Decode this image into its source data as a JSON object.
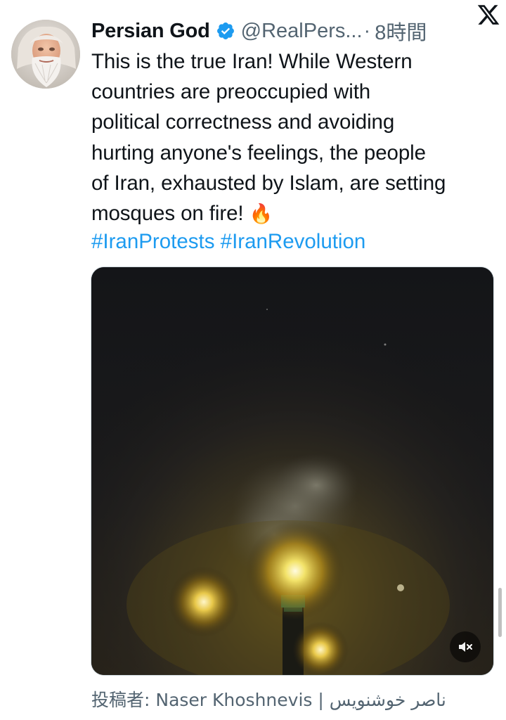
{
  "author": {
    "display_name": "Persian God",
    "handle": "@RealPers...",
    "separator": "·",
    "time": "8時間",
    "verified": true,
    "avatar_icon": "bearded-man-avatar"
  },
  "tweet": {
    "lines": [
      "This is the true Iran! While Western",
      "countries are preoccupied with",
      "political correctness and avoiding",
      "hurting anyone's feelings, the people",
      "of Iran, exhausted by Islam, are setting",
      "mosques on fire!"
    ],
    "emoji": "🔥",
    "hashtags": [
      "#IranProtests",
      "#IranRevolution"
    ]
  },
  "media": {
    "type": "video",
    "mute_icon": "speaker-muted-icon"
  },
  "credit": {
    "text": "投稿者: Naser Khoshnevis | ناصر خوشنویس"
  },
  "colors": {
    "link": "#1d9bf0",
    "verified": "#1d9bf0",
    "secondary_text": "#536471"
  }
}
